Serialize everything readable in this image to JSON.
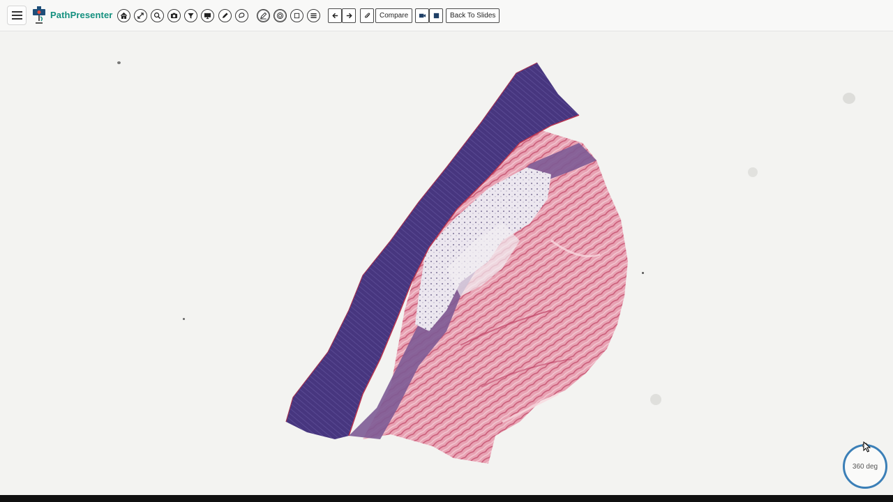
{
  "app": {
    "name": "PathPresenter",
    "brand_color": "#14907f"
  },
  "toolbar": {
    "menu_icon": "hamburger-menu-icon",
    "tools": [
      {
        "icon": "home-icon"
      },
      {
        "icon": "expand-arrows-icon"
      },
      {
        "icon": "zoom-icon"
      },
      {
        "icon": "camera-icon"
      },
      {
        "icon": "filter-icon"
      },
      {
        "icon": "monitor-icon"
      },
      {
        "icon": "pen-icon"
      },
      {
        "icon": "lasso-icon"
      },
      {
        "icon": "annotation-pen-icon"
      },
      {
        "icon": "target-icon"
      },
      {
        "icon": "rectangle-icon"
      },
      {
        "icon": "list-icon"
      }
    ],
    "nav": [
      {
        "icon": "arrow-left-icon"
      },
      {
        "icon": "arrow-right-icon"
      }
    ],
    "attach_icon": "paperclip-icon",
    "compare_label": "Compare",
    "record": [
      {
        "icon": "video-camera-icon"
      },
      {
        "icon": "stop-icon"
      }
    ],
    "back_label": "Back To Slides"
  },
  "viewer": {
    "rotation_label": "360 deg",
    "dial_color": "#3b7fb7",
    "stain_colors": {
      "epidermis": "#45357f",
      "dermis": "#e59aad"
    }
  }
}
